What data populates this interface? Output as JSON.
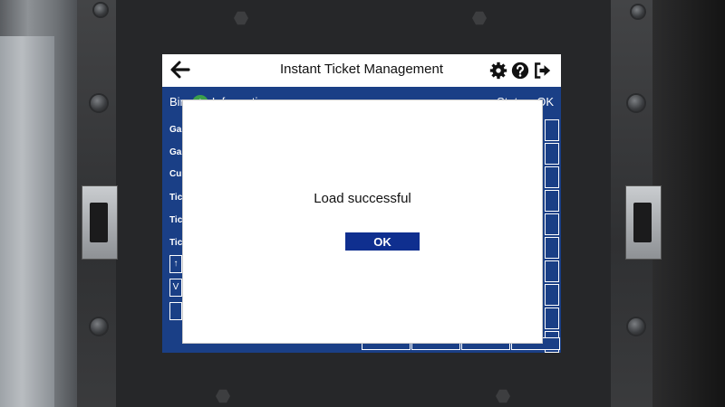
{
  "app": {
    "title": "Instant Ticket Management"
  },
  "header": {
    "back_icon": "arrow-left-icon",
    "settings_icon": "gear-icon",
    "help_icon": "question-circle-icon",
    "logout_icon": "sign-out-icon"
  },
  "status_bar": {
    "bin_label": "Bin",
    "bin_number": "1",
    "info_label": "Information",
    "status_label": "Status",
    "status_value": "OK"
  },
  "rows": [
    "Ga",
    "Ga",
    "Cu",
    "Tic",
    "Tic",
    "Tic"
  ],
  "left_cells": [
    "↑",
    "V",
    ""
  ],
  "dialog": {
    "message": "Load successful",
    "ok_label": "OK"
  },
  "colors": {
    "primary_blue": "#1a3f86",
    "button_blue": "#0f2f8f",
    "badge_green": "#3ca04a"
  }
}
